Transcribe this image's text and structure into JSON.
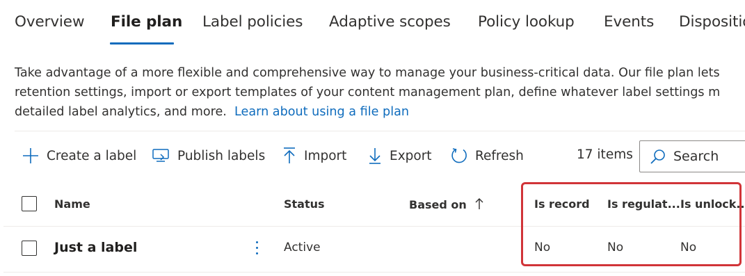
{
  "tabs": [
    {
      "label": "Overview",
      "selected": false
    },
    {
      "label": "File plan",
      "selected": true
    },
    {
      "label": "Label policies",
      "selected": false
    },
    {
      "label": "Adaptive scopes",
      "selected": false
    },
    {
      "label": "Policy lookup",
      "selected": false
    },
    {
      "label": "Events",
      "selected": false
    },
    {
      "label": "Dispositio",
      "selected": false
    }
  ],
  "description": {
    "line1": "Take advantage of a more flexible and comprehensive way to manage your business-critical data. Our file plan lets",
    "line2": "retention settings, import or export templates of your content management plan, define whatever label settings m",
    "line3": "detailed label analytics, and more.",
    "link": "Learn about using a file plan"
  },
  "toolbar": {
    "create_label": "Create a label",
    "publish_labels": "Publish labels",
    "import": "Import",
    "export": "Export",
    "refresh": "Refresh",
    "items_count": "17 items",
    "search_placeholder": "Search"
  },
  "table": {
    "columns": {
      "name": "Name",
      "status": "Status",
      "based_on": "Based on",
      "is_record": "Is record",
      "is_regulatory": "Is regulat...",
      "is_unlocked": "Is unlock..."
    },
    "rows": [
      {
        "name": "Just a label",
        "status": "Active",
        "based_on": "",
        "is_record": "No",
        "is_regulatory": "No",
        "is_unlocked": "No"
      }
    ]
  },
  "colors": {
    "accent": "#0f6cbd",
    "highlight": "#d13438",
    "text": "#323130"
  }
}
